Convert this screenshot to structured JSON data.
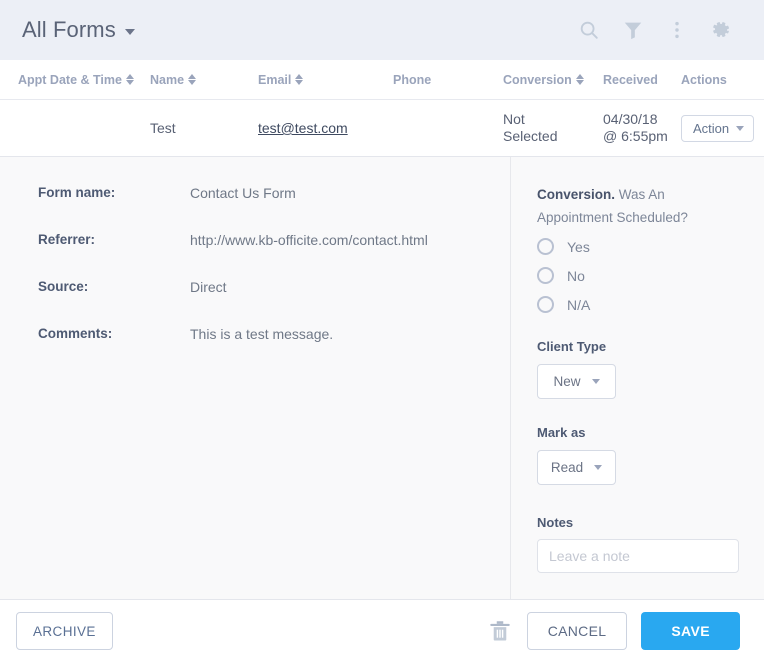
{
  "topbar": {
    "title": "All Forms",
    "icons": [
      {
        "name": "search-icon"
      },
      {
        "name": "filter-icon"
      },
      {
        "name": "more-vertical-icon"
      },
      {
        "name": "gear-icon"
      }
    ]
  },
  "table": {
    "columns": [
      {
        "label": "Appt Date & Time",
        "sortable": true
      },
      {
        "label": "Name",
        "sortable": true
      },
      {
        "label": "Email",
        "sortable": true
      },
      {
        "label": "Phone",
        "sortable": false
      },
      {
        "label": "Conversion",
        "sortable": true
      },
      {
        "label": "Received",
        "sortable": false
      },
      {
        "label": "Actions",
        "sortable": false
      }
    ],
    "row": {
      "appt_date_time": "",
      "name": "Test",
      "email": "test@test.com",
      "phone": "",
      "conversion_line1": "Not",
      "conversion_line2": "Selected",
      "received_line1": "04/30/18",
      "received_line2": "@ 6:55pm",
      "action_label": "Action"
    }
  },
  "detail": {
    "fields": [
      {
        "label": "Form name:",
        "value": "Contact Us Form"
      },
      {
        "label": "Referrer:",
        "value": "http://www.kb-officite.com/contact.html"
      },
      {
        "label": "Source:",
        "value": "Direct"
      },
      {
        "label": "Comments:",
        "value": "This is a test message."
      }
    ]
  },
  "panel": {
    "conversion_bold": "Conversion.",
    "conversion_question": " Was An Appointment Scheduled?",
    "radios": [
      {
        "label": "Yes",
        "selected": false
      },
      {
        "label": "No",
        "selected": false
      },
      {
        "label": "N/A",
        "selected": false
      }
    ],
    "client_type_label": "Client Type",
    "client_type_value": "New",
    "mark_as_label": "Mark as",
    "mark_as_value": "Read",
    "notes_label": "Notes",
    "notes_value": "",
    "notes_placeholder": "Leave a note"
  },
  "footer": {
    "archive_label": "ARCHIVE",
    "delete_icon": "trash-icon",
    "cancel_label": "CANCEL",
    "save_label": "SAVE"
  },
  "colors": {
    "topbar_bg": "#eceff6",
    "accent_blue": "#29a8f0",
    "muted_text": "#9aa4bb"
  }
}
